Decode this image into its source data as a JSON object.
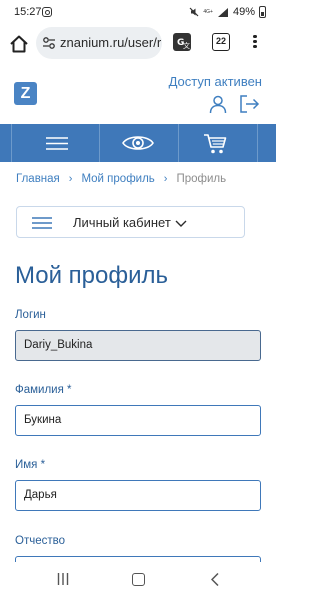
{
  "status_bar": {
    "time": "15:27",
    "network": "4G+",
    "battery": "49%"
  },
  "browser": {
    "url": "znanium.ru/user/r",
    "tabs_count": "22"
  },
  "header": {
    "logo_letter": "Z",
    "access_status": "Доступ активен"
  },
  "breadcrumb": {
    "items": [
      "Главная",
      "Мой профиль",
      "Профиль"
    ]
  },
  "cabinet_menu": {
    "label": "Личный кабинет"
  },
  "page": {
    "title": "Мой профиль"
  },
  "form": {
    "login": {
      "label": "Логин",
      "value": "Dariy_Bukina"
    },
    "surname": {
      "label": "Фамилия *",
      "value": "Букина"
    },
    "name": {
      "label": "Имя *",
      "value": "Дарья"
    },
    "patronymic": {
      "label": "Отчество",
      "value": ""
    }
  },
  "colors": {
    "accent": "#3f78b9",
    "link": "#3f7fc0",
    "title": "#2a5f98"
  }
}
